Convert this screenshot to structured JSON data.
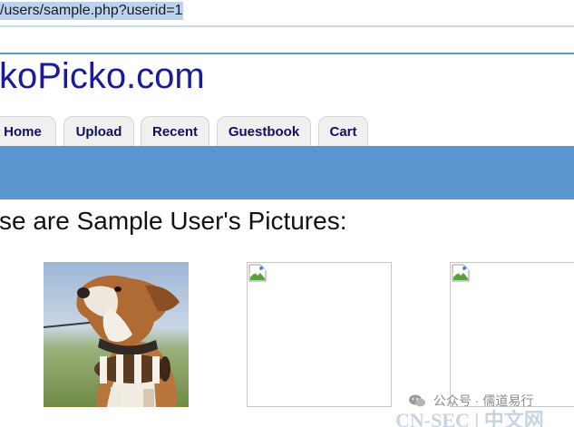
{
  "browser": {
    "url": "/users/sample.php?userid=1"
  },
  "site": {
    "title": "koPicko.com"
  },
  "nav": {
    "tabs": [
      {
        "label": "Home"
      },
      {
        "label": "Upload"
      },
      {
        "label": "Recent"
      },
      {
        "label": "Guestbook"
      },
      {
        "label": "Cart"
      }
    ]
  },
  "main": {
    "heading": "se are Sample User's Pictures:",
    "pictures": [
      {
        "state": "loaded",
        "subject": "dog-photo"
      },
      {
        "state": "broken",
        "icon": "broken-image-icon"
      },
      {
        "state": "broken",
        "icon": "broken-image-icon"
      }
    ]
  },
  "watermark": {
    "channel": "公众号 · 儒道易行",
    "brand": "CN-SEC | 中文网"
  },
  "colors": {
    "title": "#1a1a9c",
    "tab_text": "#101060",
    "band": "#5b96d0",
    "url_highlight": "#bcd3ef"
  }
}
